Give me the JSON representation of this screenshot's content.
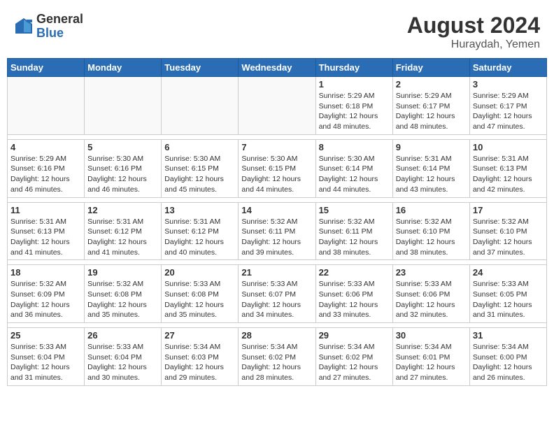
{
  "header": {
    "logo_general": "General",
    "logo_blue": "Blue",
    "month_year": "August 2024",
    "location": "Huraydah, Yemen"
  },
  "days_of_week": [
    "Sunday",
    "Monday",
    "Tuesday",
    "Wednesday",
    "Thursday",
    "Friday",
    "Saturday"
  ],
  "weeks": [
    [
      {
        "day": "",
        "info": ""
      },
      {
        "day": "",
        "info": ""
      },
      {
        "day": "",
        "info": ""
      },
      {
        "day": "",
        "info": ""
      },
      {
        "day": "1",
        "info": "Sunrise: 5:29 AM\nSunset: 6:18 PM\nDaylight: 12 hours\nand 48 minutes."
      },
      {
        "day": "2",
        "info": "Sunrise: 5:29 AM\nSunset: 6:17 PM\nDaylight: 12 hours\nand 48 minutes."
      },
      {
        "day": "3",
        "info": "Sunrise: 5:29 AM\nSunset: 6:17 PM\nDaylight: 12 hours\nand 47 minutes."
      }
    ],
    [
      {
        "day": "4",
        "info": "Sunrise: 5:29 AM\nSunset: 6:16 PM\nDaylight: 12 hours\nand 46 minutes."
      },
      {
        "day": "5",
        "info": "Sunrise: 5:30 AM\nSunset: 6:16 PM\nDaylight: 12 hours\nand 46 minutes."
      },
      {
        "day": "6",
        "info": "Sunrise: 5:30 AM\nSunset: 6:15 PM\nDaylight: 12 hours\nand 45 minutes."
      },
      {
        "day": "7",
        "info": "Sunrise: 5:30 AM\nSunset: 6:15 PM\nDaylight: 12 hours\nand 44 minutes."
      },
      {
        "day": "8",
        "info": "Sunrise: 5:30 AM\nSunset: 6:14 PM\nDaylight: 12 hours\nand 44 minutes."
      },
      {
        "day": "9",
        "info": "Sunrise: 5:31 AM\nSunset: 6:14 PM\nDaylight: 12 hours\nand 43 minutes."
      },
      {
        "day": "10",
        "info": "Sunrise: 5:31 AM\nSunset: 6:13 PM\nDaylight: 12 hours\nand 42 minutes."
      }
    ],
    [
      {
        "day": "11",
        "info": "Sunrise: 5:31 AM\nSunset: 6:13 PM\nDaylight: 12 hours\nand 41 minutes."
      },
      {
        "day": "12",
        "info": "Sunrise: 5:31 AM\nSunset: 6:12 PM\nDaylight: 12 hours\nand 41 minutes."
      },
      {
        "day": "13",
        "info": "Sunrise: 5:31 AM\nSunset: 6:12 PM\nDaylight: 12 hours\nand 40 minutes."
      },
      {
        "day": "14",
        "info": "Sunrise: 5:32 AM\nSunset: 6:11 PM\nDaylight: 12 hours\nand 39 minutes."
      },
      {
        "day": "15",
        "info": "Sunrise: 5:32 AM\nSunset: 6:11 PM\nDaylight: 12 hours\nand 38 minutes."
      },
      {
        "day": "16",
        "info": "Sunrise: 5:32 AM\nSunset: 6:10 PM\nDaylight: 12 hours\nand 38 minutes."
      },
      {
        "day": "17",
        "info": "Sunrise: 5:32 AM\nSunset: 6:10 PM\nDaylight: 12 hours\nand 37 minutes."
      }
    ],
    [
      {
        "day": "18",
        "info": "Sunrise: 5:32 AM\nSunset: 6:09 PM\nDaylight: 12 hours\nand 36 minutes."
      },
      {
        "day": "19",
        "info": "Sunrise: 5:32 AM\nSunset: 6:08 PM\nDaylight: 12 hours\nand 35 minutes."
      },
      {
        "day": "20",
        "info": "Sunrise: 5:33 AM\nSunset: 6:08 PM\nDaylight: 12 hours\nand 35 minutes."
      },
      {
        "day": "21",
        "info": "Sunrise: 5:33 AM\nSunset: 6:07 PM\nDaylight: 12 hours\nand 34 minutes."
      },
      {
        "day": "22",
        "info": "Sunrise: 5:33 AM\nSunset: 6:06 PM\nDaylight: 12 hours\nand 33 minutes."
      },
      {
        "day": "23",
        "info": "Sunrise: 5:33 AM\nSunset: 6:06 PM\nDaylight: 12 hours\nand 32 minutes."
      },
      {
        "day": "24",
        "info": "Sunrise: 5:33 AM\nSunset: 6:05 PM\nDaylight: 12 hours\nand 31 minutes."
      }
    ],
    [
      {
        "day": "25",
        "info": "Sunrise: 5:33 AM\nSunset: 6:04 PM\nDaylight: 12 hours\nand 31 minutes."
      },
      {
        "day": "26",
        "info": "Sunrise: 5:33 AM\nSunset: 6:04 PM\nDaylight: 12 hours\nand 30 minutes."
      },
      {
        "day": "27",
        "info": "Sunrise: 5:34 AM\nSunset: 6:03 PM\nDaylight: 12 hours\nand 29 minutes."
      },
      {
        "day": "28",
        "info": "Sunrise: 5:34 AM\nSunset: 6:02 PM\nDaylight: 12 hours\nand 28 minutes."
      },
      {
        "day": "29",
        "info": "Sunrise: 5:34 AM\nSunset: 6:02 PM\nDaylight: 12 hours\nand 27 minutes."
      },
      {
        "day": "30",
        "info": "Sunrise: 5:34 AM\nSunset: 6:01 PM\nDaylight: 12 hours\nand 27 minutes."
      },
      {
        "day": "31",
        "info": "Sunrise: 5:34 AM\nSunset: 6:00 PM\nDaylight: 12 hours\nand 26 minutes."
      }
    ]
  ]
}
